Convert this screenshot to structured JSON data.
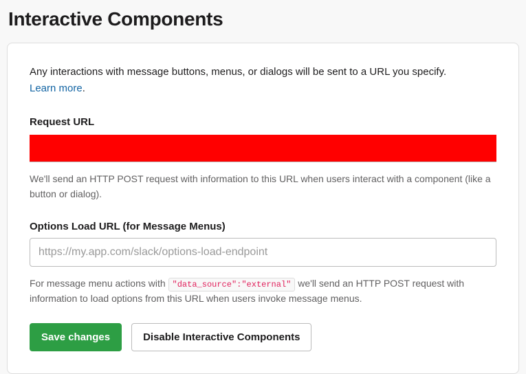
{
  "page_title": "Interactive Components",
  "intro": "Any interactions with message buttons, menus, or dialogs will be sent to a URL you specify.",
  "learn_more_label": "Learn more",
  "learn_more_dot": ".",
  "request_url": {
    "label": "Request URL",
    "value": "",
    "help": "We'll send an HTTP POST request with information to this URL when users interact with a component (like a button or dialog)."
  },
  "options_load_url": {
    "label": "Options Load URL (for Message Menus)",
    "placeholder": "https://my.app.com/slack/options-load-endpoint",
    "value": "",
    "help_pre": "For message menu actions with ",
    "code": "\"data_source\":\"external\"",
    "help_post": " we'll send an HTTP POST request with information to load options from this URL when users invoke message menus."
  },
  "buttons": {
    "save": "Save changes",
    "disable": "Disable Interactive Components"
  }
}
